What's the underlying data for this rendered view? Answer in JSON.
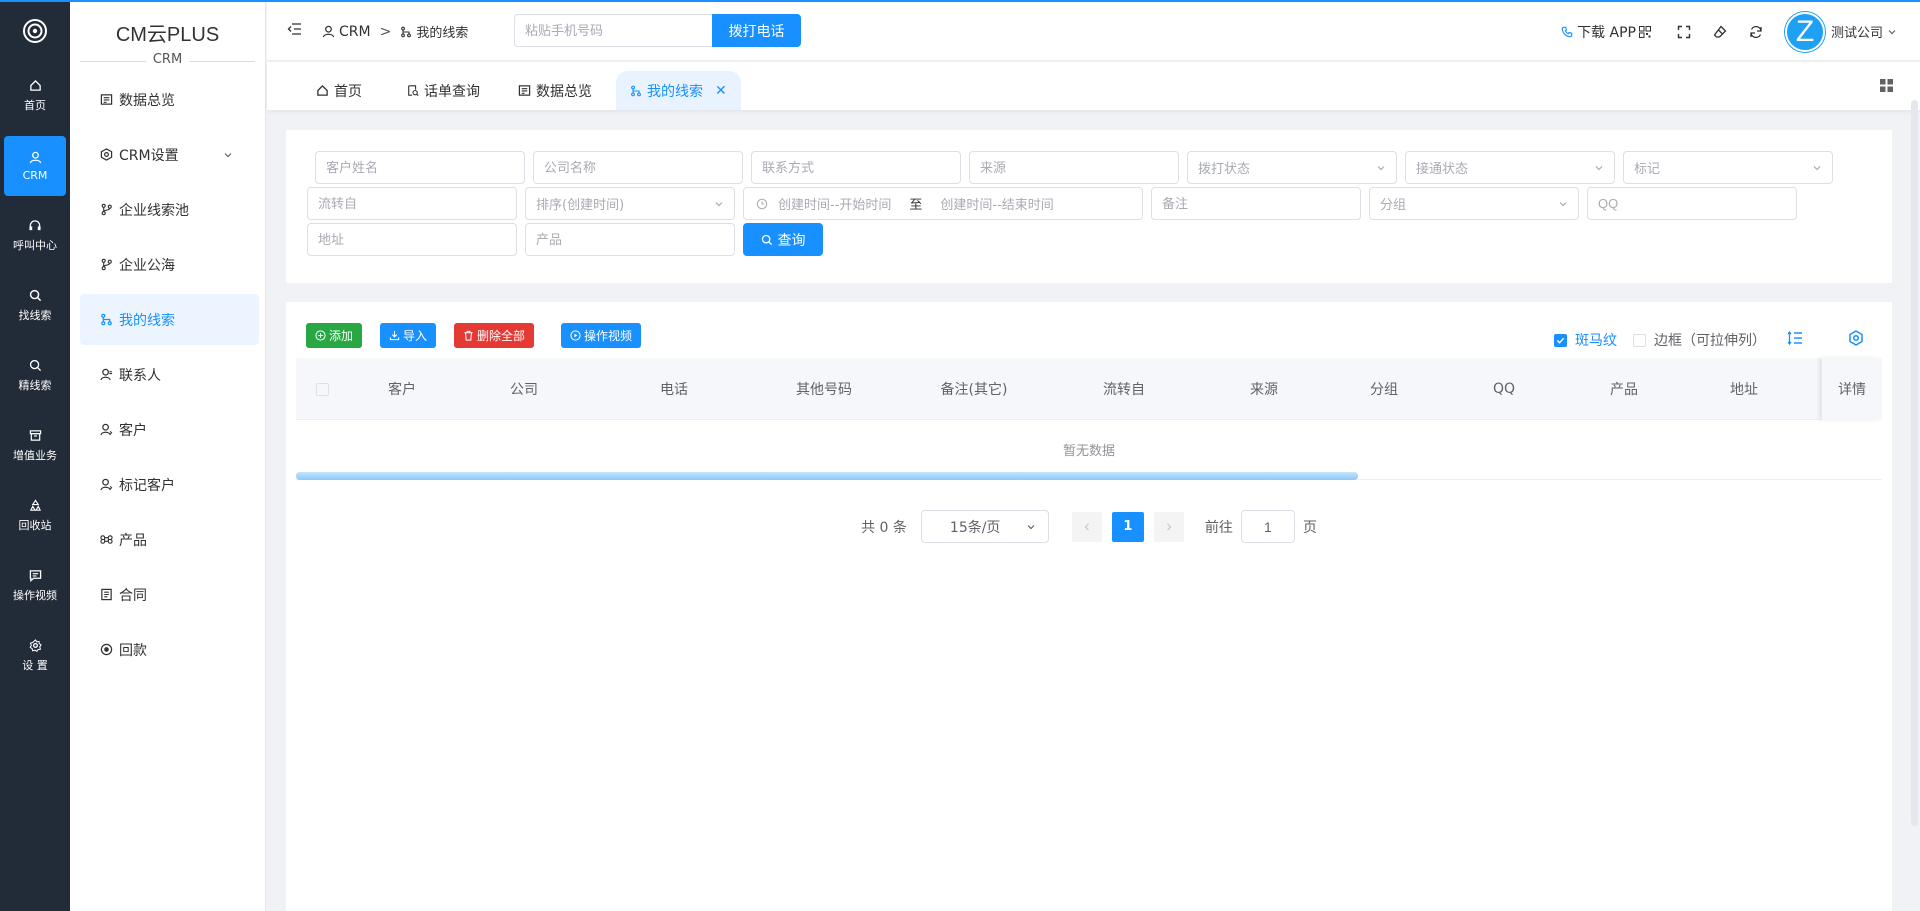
{
  "rail": {
    "items": [
      {
        "label": "首页",
        "icon": "home-icon"
      },
      {
        "label": "CRM",
        "icon": "user-icon",
        "active": true
      },
      {
        "label": "呼叫中心",
        "icon": "headset-icon"
      },
      {
        "label": "找线索",
        "icon": "search-icon"
      },
      {
        "label": "精线索",
        "icon": "search-icon"
      },
      {
        "label": "增值业务",
        "icon": "box-icon"
      },
      {
        "label": "回收站",
        "icon": "recycle-icon"
      },
      {
        "label": "操作视频",
        "icon": "chat-icon"
      },
      {
        "label": "设 置",
        "icon": "gear-icon"
      }
    ]
  },
  "sidebar": {
    "brand_title": "CM云PLUS",
    "brand_sub": "CRM",
    "items": [
      {
        "label": "数据总览",
        "icon": "dashboard-icon"
      },
      {
        "label": "CRM设置",
        "icon": "settings-icon"
      },
      {
        "label": "企业线索池",
        "icon": "branch-icon"
      },
      {
        "label": "企业公海",
        "icon": "branch-icon"
      },
      {
        "label": "我的线索",
        "icon": "flow-icon",
        "active": true
      },
      {
        "label": "联系人",
        "icon": "contact-icon"
      },
      {
        "label": "客户",
        "icon": "customer-icon"
      },
      {
        "label": "标记客户",
        "icon": "customer-icon"
      },
      {
        "label": "产品",
        "icon": "command-icon"
      },
      {
        "label": "合同",
        "icon": "document-icon"
      },
      {
        "label": "回款",
        "icon": "payment-icon"
      }
    ]
  },
  "header": {
    "crumb_root": "CRM",
    "crumb_sep": ">",
    "crumb_current": "我的线索",
    "phone_placeholder": "粘贴手机号码",
    "call_button": "拨打电话",
    "download_app": "下载 APP",
    "avatar_letter": "Z",
    "company": "测试公司"
  },
  "tabs": [
    {
      "label": "首页"
    },
    {
      "label": "话单查询"
    },
    {
      "label": "数据总览"
    },
    {
      "label": "我的线索",
      "active": true
    }
  ],
  "filters": {
    "customer_name": "客户姓名",
    "company_name": "公司名称",
    "contact": "联系方式",
    "source": "来源",
    "dial_status": "拨打状态",
    "connect_status": "接通状态",
    "mark": "标记",
    "flow_from": "流转自",
    "sort": "排序(创建时间)",
    "start_time": "创建时间--开始时间",
    "range_sep": "至",
    "end_time": "创建时间--结束时间",
    "remark": "备注",
    "group": "分组",
    "qq": "QQ",
    "address": "地址",
    "product": "产品",
    "query_button": "查询"
  },
  "toolbar": {
    "add": "添加",
    "import": "导入",
    "delete_all": "删除全部",
    "video": "操作视频",
    "zebra": "斑马纹",
    "border": "边框（可拉伸列）"
  },
  "table": {
    "columns": [
      "客户",
      "公司",
      "电话",
      "其他号码",
      "备注(其它)",
      "流转自",
      "来源",
      "分组",
      "QQ",
      "产品",
      "地址"
    ],
    "fixed_column": "详情",
    "empty_text": "暂无数据"
  },
  "pagination": {
    "total": "共 0 条",
    "page_size": "15条/页",
    "current_page": "1",
    "goto_label": "前往",
    "goto_value": "1",
    "page_suffix": "页"
  },
  "colors": {
    "primary": "#1890ff",
    "rail_bg": "#222b38",
    "add_button": "#28a745",
    "delete_button": "#e53935"
  }
}
